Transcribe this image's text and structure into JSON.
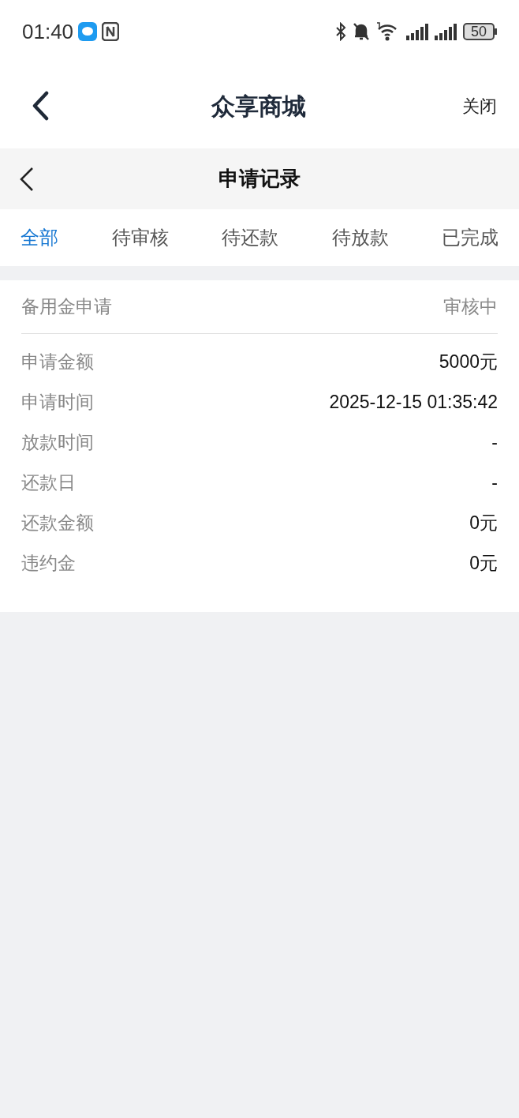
{
  "status_bar": {
    "time": "01:40",
    "battery": "50"
  },
  "header": {
    "title": "众享商城",
    "close": "关闭"
  },
  "subheader": {
    "title": "申请记录"
  },
  "tabs": [
    {
      "label": "全部",
      "selected": true
    },
    {
      "label": "待审核",
      "selected": false
    },
    {
      "label": "待还款",
      "selected": false
    },
    {
      "label": "待放款",
      "selected": false
    },
    {
      "label": "已完成",
      "selected": false
    }
  ],
  "record": {
    "title": "备用金申请",
    "status": "审核中",
    "rows": [
      {
        "label": "申请金额",
        "value": "5000元"
      },
      {
        "label": "申请时间",
        "value": "2025-12-15 01:35:42"
      },
      {
        "label": "放款时间",
        "value": "-"
      },
      {
        "label": "还款日",
        "value": "-"
      },
      {
        "label": "还款金额",
        "value": "0元"
      },
      {
        "label": "违约金",
        "value": "0元"
      }
    ]
  }
}
